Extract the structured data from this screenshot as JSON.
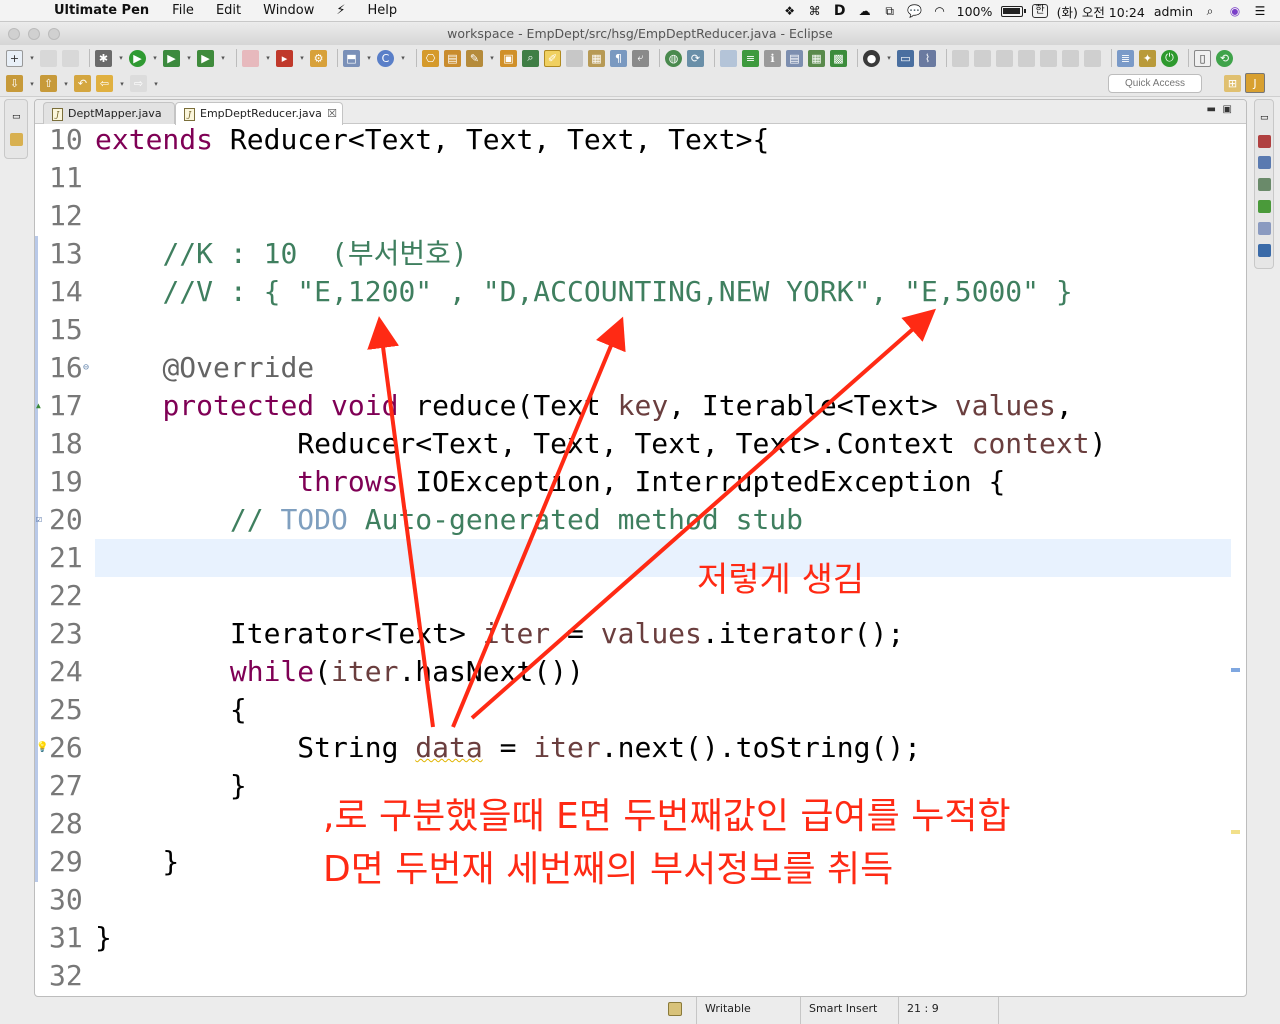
{
  "menubar": {
    "app_name": "Ultimate Pen",
    "items": [
      "File",
      "Edit",
      "Window",
      "⚡",
      "Help"
    ],
    "battery_percent": "100%",
    "input_method": "한",
    "datetime": "(화) 오전 10:24",
    "user": "admin"
  },
  "window": {
    "title": "workspace - EmpDept/src/hsg/EmpDeptReducer.java - Eclipse"
  },
  "toolbar": {
    "quick_access_placeholder": "Quick Access"
  },
  "tabs": [
    {
      "label": "DeptMapper.java",
      "active": false
    },
    {
      "label": "EmpDeptReducer.java",
      "active": true,
      "close": "☒"
    }
  ],
  "code_lines": [
    {
      "num": "10",
      "html": "<span class=\"kw\">extends</span> Reducer&lt;Text, Text, Text, Text&gt;{"
    },
    {
      "num": "11",
      "html": ""
    },
    {
      "num": "12",
      "html": ""
    },
    {
      "num": "13",
      "html": "    <span class=\"cm\">//K : 10  (부서번호)</span>"
    },
    {
      "num": "14",
      "html": "    <span class=\"cm\">//V : { \"E,1200\" , \"D,ACCOUNTING,NEW YORK\", \"E,5000\" }</span>"
    },
    {
      "num": "15",
      "html": ""
    },
    {
      "num": "16",
      "html": "    <span class=\"an\">@Override</span>",
      "marker": "⊖"
    },
    {
      "num": "17",
      "html": "    <span class=\"kw\">protected</span> <span class=\"kw\">void</span> reduce(Text <span class=\"vr\">key</span>, Iterable&lt;Text&gt; <span class=\"vr\">values</span>,",
      "marker": "▲"
    },
    {
      "num": "18",
      "html": "            Reducer&lt;Text, Text, Text, Text&gt;.Context <span class=\"vr\">context</span>)"
    },
    {
      "num": "19",
      "html": "            <span class=\"kw\">throws</span> IOException, InterruptedException {"
    },
    {
      "num": "20",
      "html": "        <span class=\"cm\">// <span class=\"todo\">TODO</span> Auto-generated method stub</span>",
      "marker": "☑"
    },
    {
      "num": "21",
      "html": "",
      "current": true
    },
    {
      "num": "22",
      "html": ""
    },
    {
      "num": "23",
      "html": "        Iterator&lt;Text&gt; <span class=\"vr\">iter</span> = <span class=\"vr\">values</span>.iterator();"
    },
    {
      "num": "24",
      "html": "        <span class=\"kw\">while</span>(<span class=\"vr\">iter</span>.hasNext())"
    },
    {
      "num": "25",
      "html": "        {"
    },
    {
      "num": "26",
      "html": "            String <span class=\"vr warnline\">data</span> = <span class=\"vr\">iter</span>.next().toString();",
      "marker": "💡"
    },
    {
      "num": "27",
      "html": "        }"
    },
    {
      "num": "28",
      "html": ""
    },
    {
      "num": "29",
      "html": "    }"
    },
    {
      "num": "30",
      "html": ""
    },
    {
      "num": "31",
      "html": "}"
    },
    {
      "num": "32",
      "html": ""
    }
  ],
  "annotations": {
    "label1": "저렇게 생김",
    "label2": ",로 구분했을때 E면 두번째값인 급여를 누적합",
    "label3": "D면 두번재 세번째의 부서정보를 취득"
  },
  "statusbar": {
    "mode": "Writable",
    "insert_mode": "Smart Insert",
    "position": "21 : 9"
  },
  "colors": {
    "arrow": "#ff2a14",
    "keyword": "#7f0055",
    "comment": "#3f7f5f"
  }
}
